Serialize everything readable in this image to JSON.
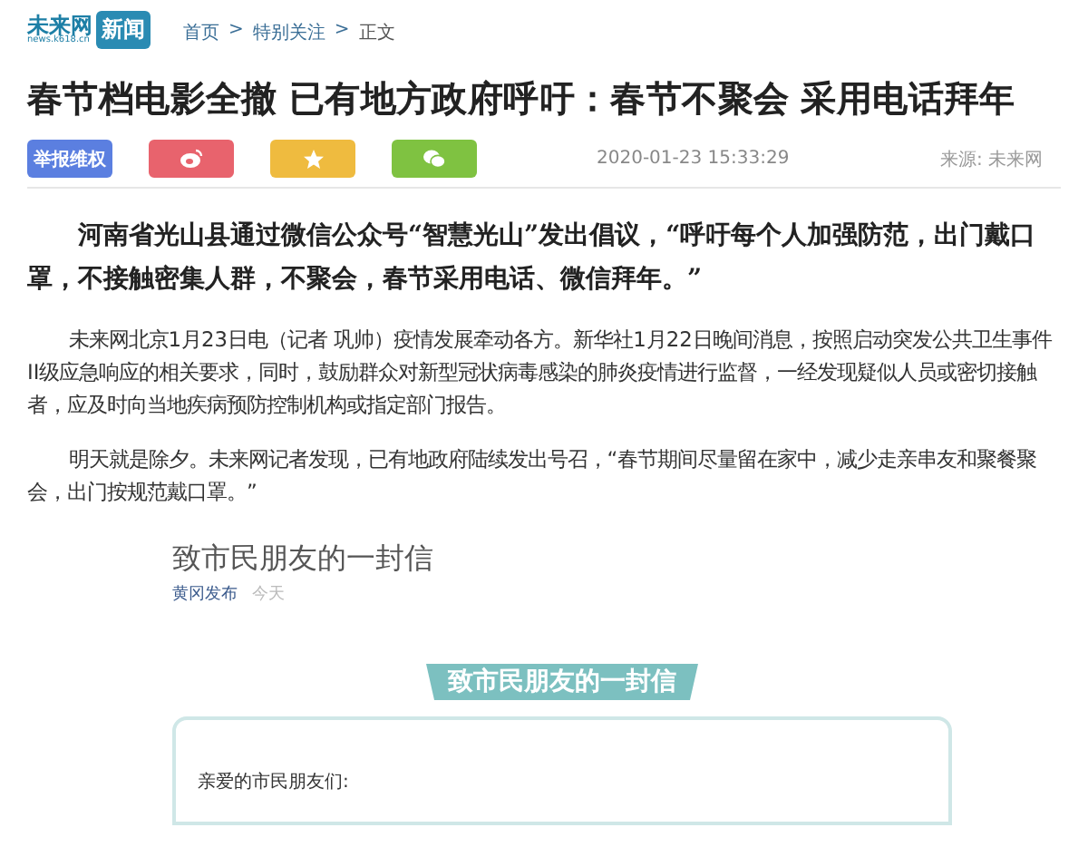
{
  "header": {
    "logo": {
      "name": "未来网",
      "url": "news.k618.cn",
      "badge": "新闻"
    },
    "breadcrumb": [
      {
        "label": "首页"
      },
      {
        "label": "特别关注"
      },
      {
        "label": "正文"
      }
    ],
    "separator": ">"
  },
  "article": {
    "title": "春节档电影全撤 已有地方政府呼吁：春节不聚会 采用电话拜年",
    "actions": [
      {
        "kind": "report",
        "label": "举报维权",
        "color": "#5b7fe0"
      },
      {
        "kind": "weibo",
        "color": "#e8636d"
      },
      {
        "kind": "star",
        "color": "#efbb3f"
      },
      {
        "kind": "wechat",
        "color": "#7fc241"
      }
    ],
    "date": "2020-01-23 15:33:29",
    "source": "来源: 未来网",
    "lead": "河南省光山县通过微信公众号“智慧光山”发出倡议，“呼吁每个人加强防范，出门戴口罩，不接触密集人群，不聚会，春节采用电话、微信拜年。”",
    "paragraphs": [
      "未来网北京1月23日电（记者 巩帅）疫情发展牵动各方。新华社1月22日晚间消息，按照启动突发公共卫生事件II级应急响应的相关要求，同时，鼓励群众对新型冠状病毒感染的肺炎疫情进行监督，一经发现疑似人员或密切接触者，应及时向当地疾病预防控制机构或指定部门报告。",
      "明天就是除夕。未来网记者发现，已有地政府陆续发出号召，“春节期间尽量留在家中，减少走亲串友和聚餐聚会，出门按规范戴口罩。”"
    ],
    "embed": {
      "title": "致市民朋友的一封信",
      "author": "黄冈发布",
      "time": "今天",
      "banner": "致市民朋友的一封信",
      "greeting": "亲爱的市民朋友们:"
    }
  }
}
